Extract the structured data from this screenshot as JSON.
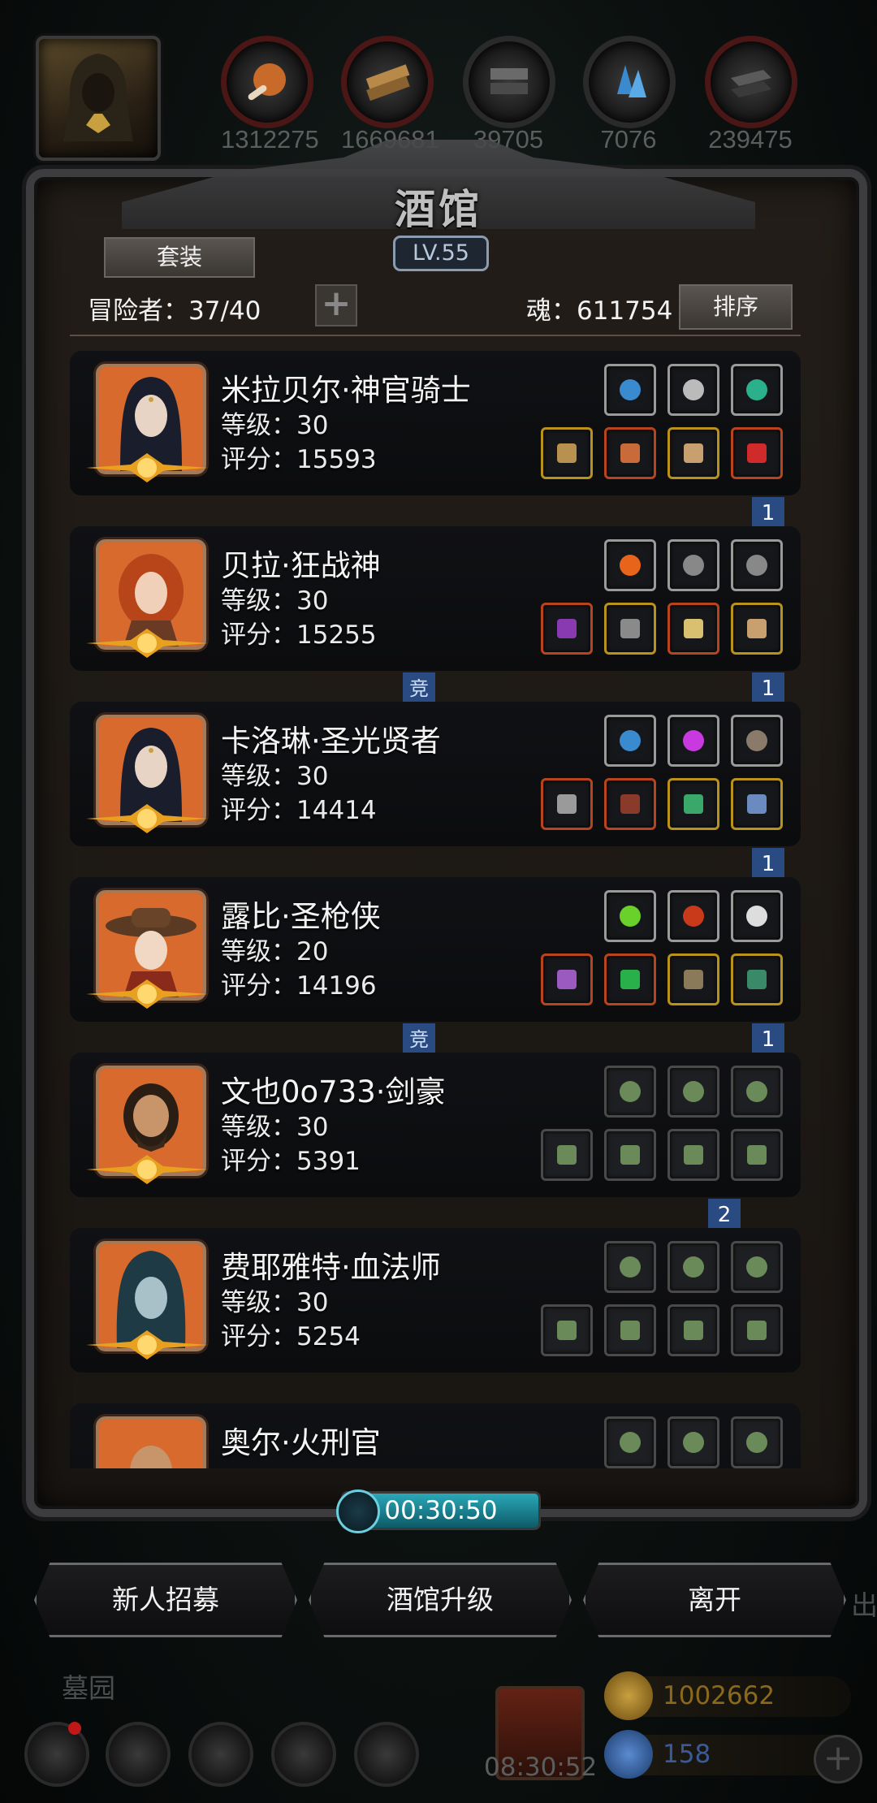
{
  "resources": [
    {
      "name": "meat-icon",
      "value": "1312275"
    },
    {
      "name": "wood-icon",
      "value": "1669681"
    },
    {
      "name": "stone-icon",
      "value": "39705"
    },
    {
      "name": "crystal-icon",
      "value": "7076"
    },
    {
      "name": "iron-icon",
      "value": "239475"
    }
  ],
  "panel": {
    "title": "酒馆",
    "level": "LV.55",
    "set_button": "套装",
    "adventurer_label": "冒险者：37/40",
    "soul_label": "魂：611754",
    "sort_button": "排序",
    "add_icon": "+"
  },
  "heroes": [
    {
      "name": "米拉贝尔·神官骑士",
      "level": "等级：30",
      "score": "评分：15593",
      "badge": "1",
      "comp": "",
      "portrait": "nun-portrait"
    },
    {
      "name": "贝拉·狂战神",
      "level": "等级：30",
      "score": "评分：15255",
      "badge": "1",
      "comp": "竞",
      "portrait": "redhair-portrait"
    },
    {
      "name": "卡洛琳·圣光贤者",
      "level": "等级：30",
      "score": "评分：14414",
      "badge": "1",
      "comp": "",
      "portrait": "nun-portrait"
    },
    {
      "name": "露比·圣枪侠",
      "level": "等级：20",
      "score": "评分：14196",
      "badge": "1",
      "comp": "竞",
      "portrait": "cowboy-portrait"
    },
    {
      "name": "文也0o733·剑豪",
      "level": "等级：30",
      "score": "评分：5391",
      "badge": "2",
      "comp": "",
      "portrait": "bearded-portrait"
    },
    {
      "name": "费耶雅特·血法师",
      "level": "等级：30",
      "score": "评分：5254",
      "badge": "",
      "comp": "",
      "portrait": "hooded-portrait"
    },
    {
      "name": "奥尔·火刑官",
      "level": "",
      "score": "",
      "badge": "",
      "comp": "",
      "portrait": "bald-portrait"
    }
  ],
  "timer": "00:30:50",
  "actions": {
    "recruit": "新人招募",
    "upgrade": "酒馆升级",
    "leave": "离开"
  },
  "bottom": {
    "location": "墓园",
    "gift_timer": "08:30:52",
    "gold": "1002662",
    "gems": "158",
    "side_text": "出"
  },
  "colors": {
    "gold_text": "#8a6a1a",
    "gem_text": "#3a5a9a",
    "badge_blue": "#2a4a82"
  }
}
